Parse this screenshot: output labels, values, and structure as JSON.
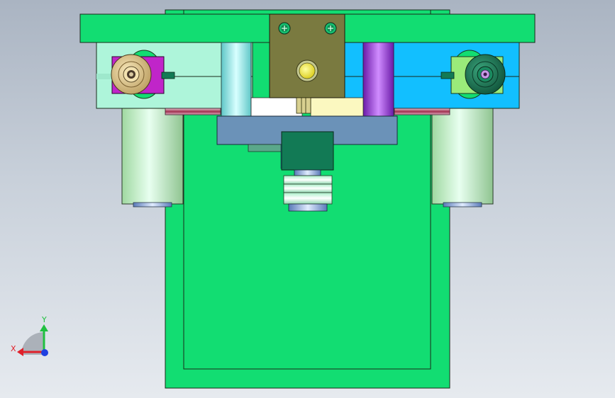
{
  "viewport": {
    "background_top": "#aab4c2",
    "background_bottom": "#e6eaef"
  },
  "triad": {
    "x_label": "X",
    "y_label": "Y",
    "x_color": "#e0202a",
    "y_color": "#20c040",
    "z_color": "#2040e0"
  },
  "model": {
    "base_color": "#12dd72",
    "plate_color": "#12dd72",
    "cyan_block": "#12bfff",
    "mint_block": "#aef5da",
    "center_block": "#7a7a40",
    "slider_color": "#6b92b8",
    "cylinder_left_color": "#8fe0a8",
    "purple_post": "#9a3bd8",
    "cyan_post": "#7ee6e6",
    "magenta_clamp": "#c025c9",
    "dark_green_part": "#127a55",
    "yellow_bolt": "#f4ee20"
  }
}
